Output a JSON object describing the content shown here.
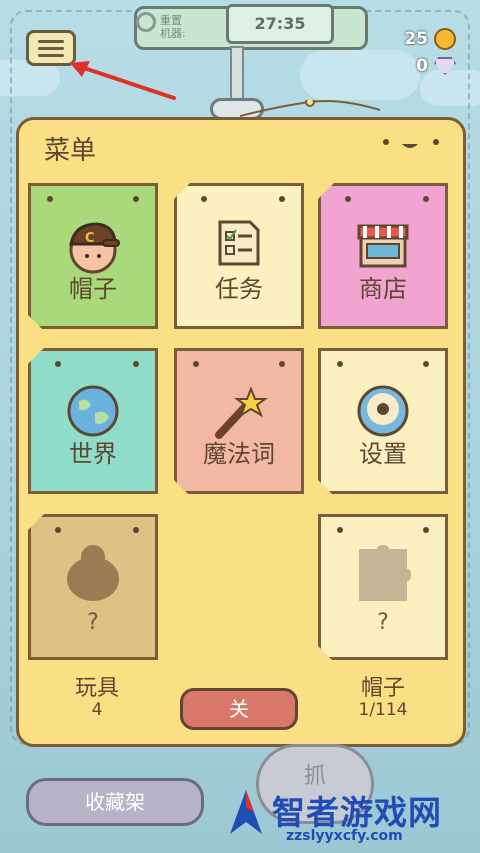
{
  "status": {
    "machine_label": "重置\n机器:",
    "timer": "27:35",
    "coins": "25",
    "gems": "0"
  },
  "menu": {
    "title": "菜单",
    "tiles": [
      {
        "label": "帽子",
        "icon": "cap-character-icon",
        "color": "#a9d97b"
      },
      {
        "label": "任务",
        "icon": "task-list-icon",
        "color": "#fbf1c0"
      },
      {
        "label": "商店",
        "icon": "shop-icon",
        "color": "#f1a4cf"
      },
      {
        "label": "世界",
        "icon": "globe-icon",
        "color": "#8fdcc9"
      },
      {
        "label": "魔法词",
        "icon": "magic-wand-icon",
        "color": "#f2b8a4"
      },
      {
        "label": "设置",
        "icon": "gear-icon",
        "color": "#fbf1c0"
      },
      {
        "label": "?",
        "icon": "locked-toy-icon",
        "color": "#e0c084"
      },
      {
        "label": "?",
        "icon": "puzzle-piece-icon",
        "color": "#fbf1c0"
      }
    ],
    "toys_label": "玩具",
    "toys_count": "4",
    "hats_label": "帽子",
    "hats_count": "1/114",
    "close_label": "关"
  },
  "bottom": {
    "collection_label": "收藏架",
    "grab_label": "抓"
  },
  "watermark": {
    "title": "智者游戏网",
    "url": "zzslyyxcfy.com"
  }
}
